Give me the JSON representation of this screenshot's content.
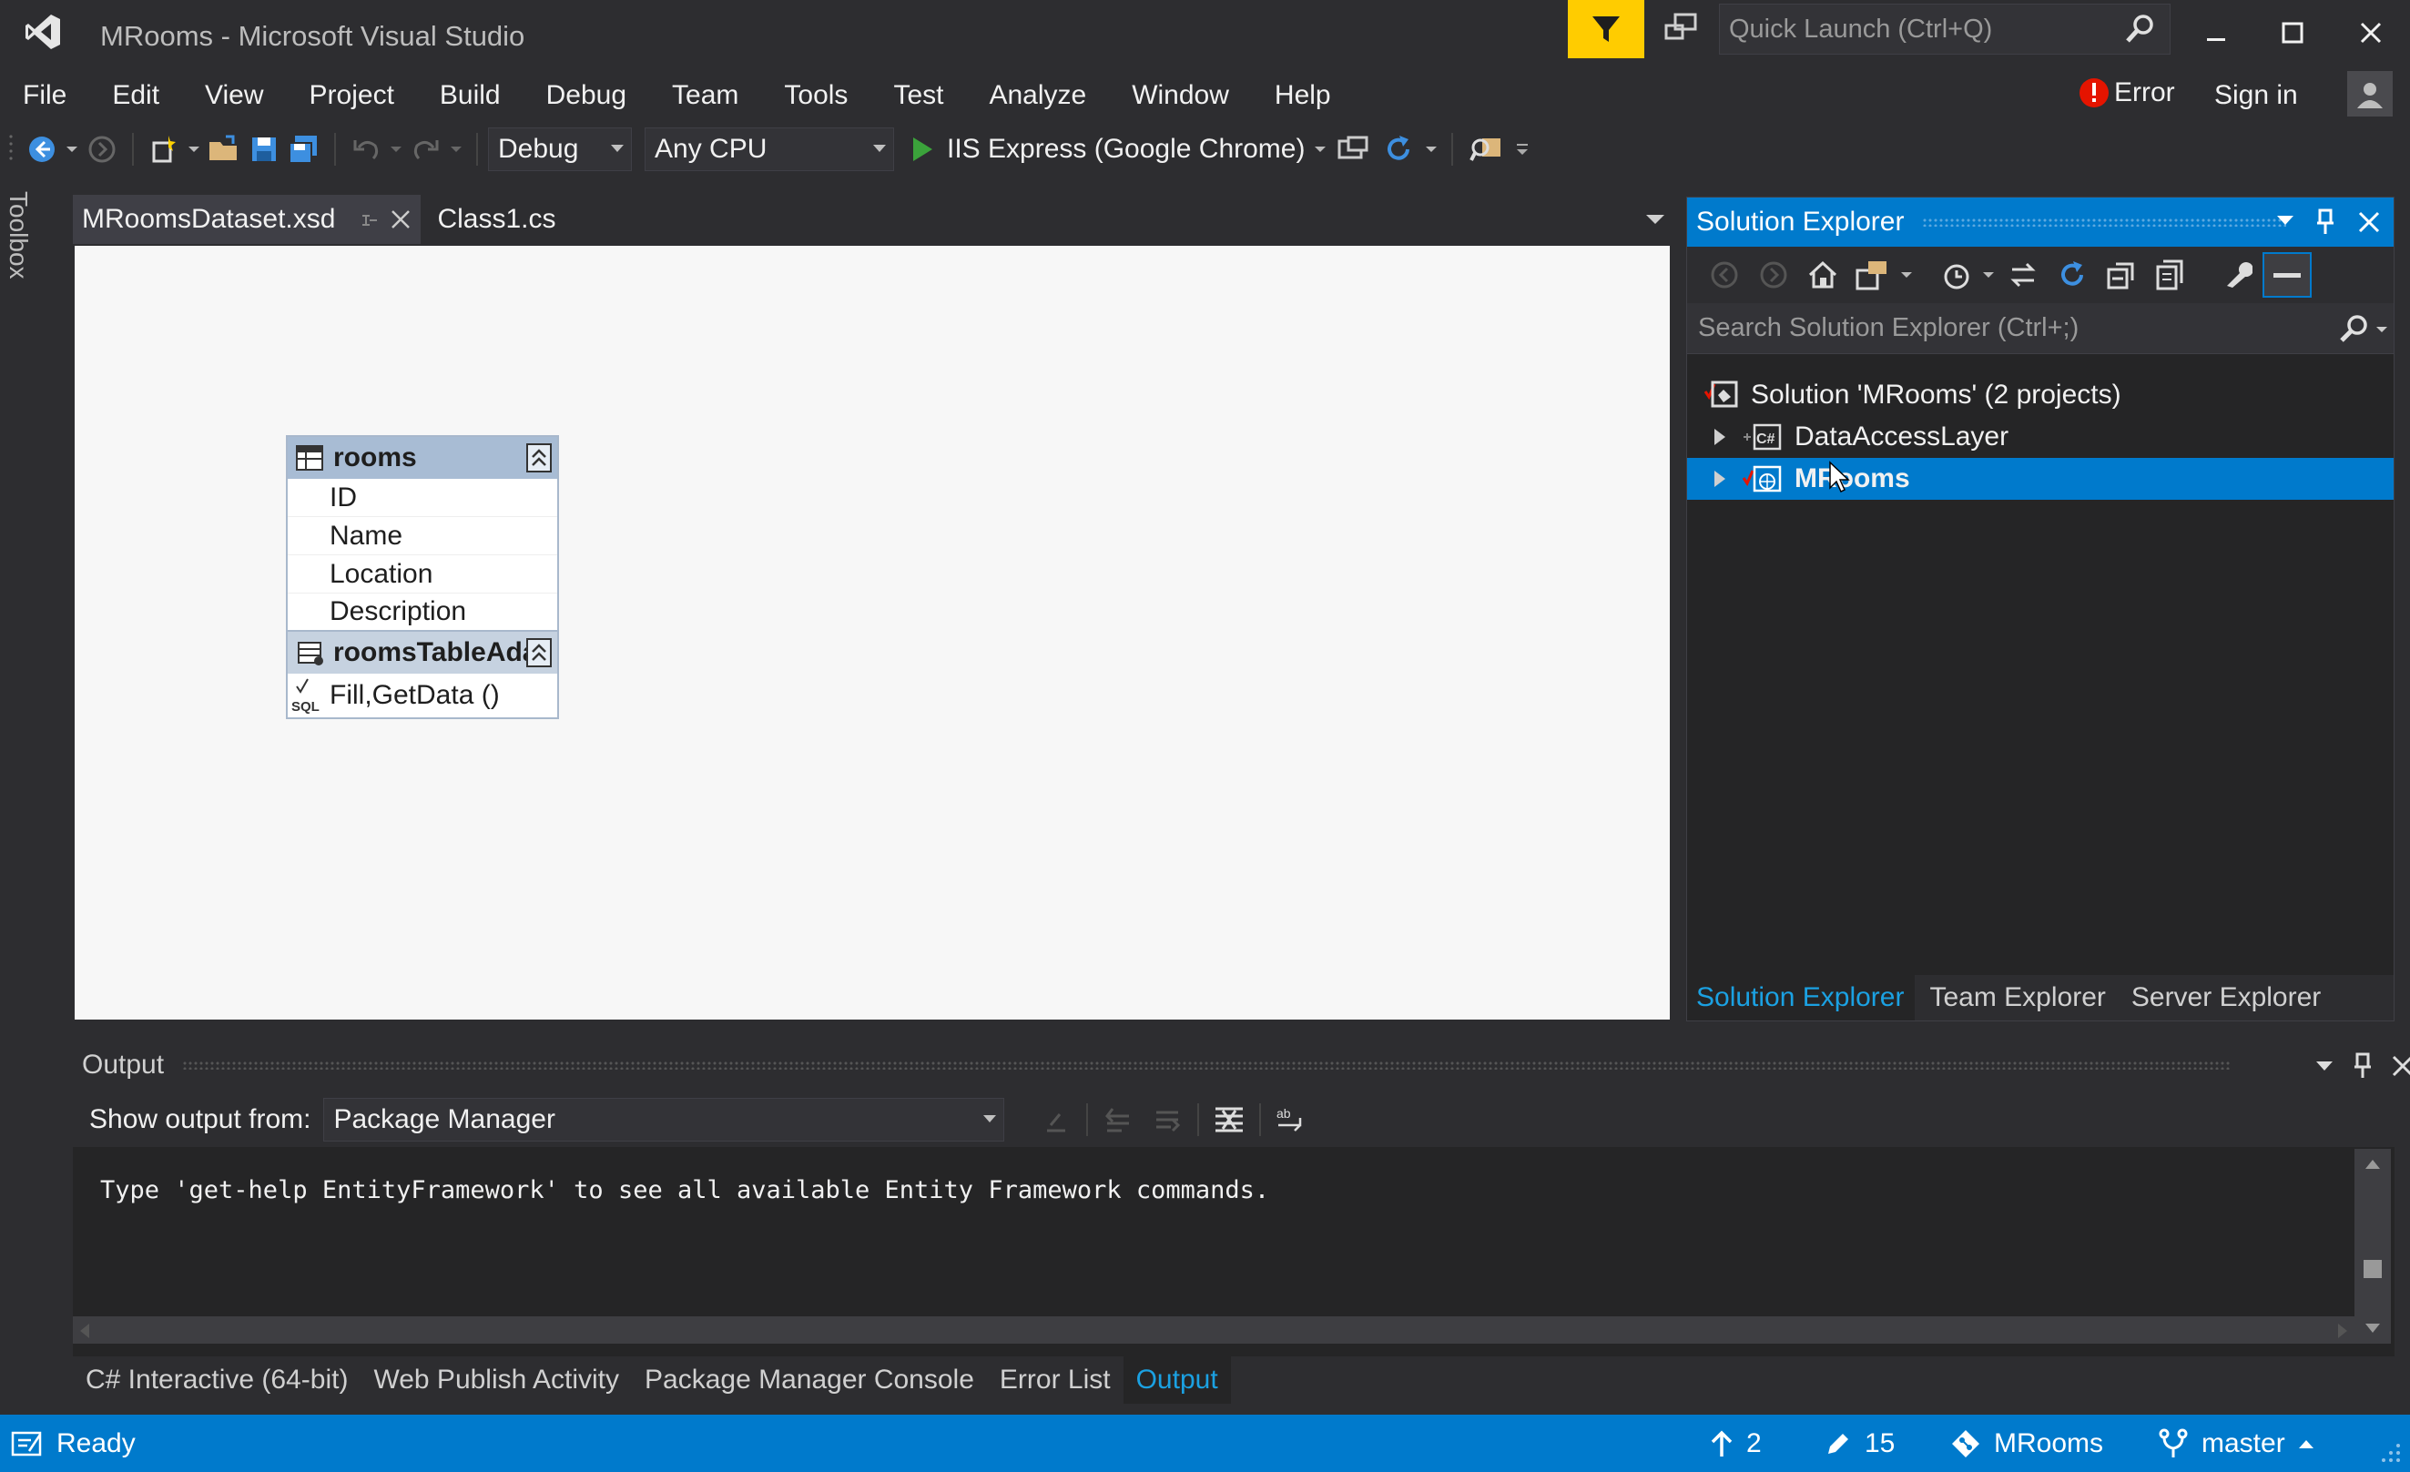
{
  "window": {
    "title": "MRooms - Microsoft Visual Studio",
    "quick_launch_placeholder": "Quick Launch (Ctrl+Q)"
  },
  "menu": {
    "items": [
      "File",
      "Edit",
      "View",
      "Project",
      "Build",
      "Debug",
      "Team",
      "Tools",
      "Test",
      "Analyze",
      "Window",
      "Help"
    ],
    "error_label": "Error",
    "sign_in": "Sign in"
  },
  "toolbar": {
    "configuration": "Debug",
    "platform": "Any CPU",
    "run_target": "IIS Express (Google Chrome)"
  },
  "toolbox": {
    "label": "Toolbox"
  },
  "doc_tabs": [
    {
      "label": "MRoomsDataset.xsd",
      "active": true
    },
    {
      "label": "Class1.cs",
      "active": false
    }
  ],
  "designer": {
    "table": {
      "name": "rooms",
      "columns": [
        "ID",
        "Name",
        "Location",
        "Description"
      ],
      "adapter_name": "roomsTableAda",
      "adapter_query": "Fill,GetData ()"
    }
  },
  "solution_explorer": {
    "title": "Solution Explorer",
    "search_placeholder": "Search Solution Explorer (Ctrl+;)",
    "tree": [
      {
        "label": "Solution 'MRooms' (2 projects)"
      },
      {
        "label": "DataAccessLayer"
      },
      {
        "label": "MRooms",
        "selected": true
      }
    ],
    "bottom_tabs": [
      "Solution Explorer",
      "Team Explorer",
      "Server Explorer"
    ]
  },
  "output": {
    "title": "Output",
    "show_from_label": "Show output from:",
    "source": "Package Manager",
    "text": "Type 'get-help EntityFramework' to see all available Entity Framework commands."
  },
  "tool_tabs": [
    "C# Interactive (64-bit)",
    "Web Publish Activity",
    "Package Manager Console",
    "Error List",
    "Output"
  ],
  "statusbar": {
    "status": "Ready",
    "unpushed": "2",
    "changes": "15",
    "repo": "MRooms",
    "branch": "master"
  },
  "colors": {
    "accent": "#007acc",
    "filter_button": "#ffcc00",
    "background": "#2d2d30"
  }
}
